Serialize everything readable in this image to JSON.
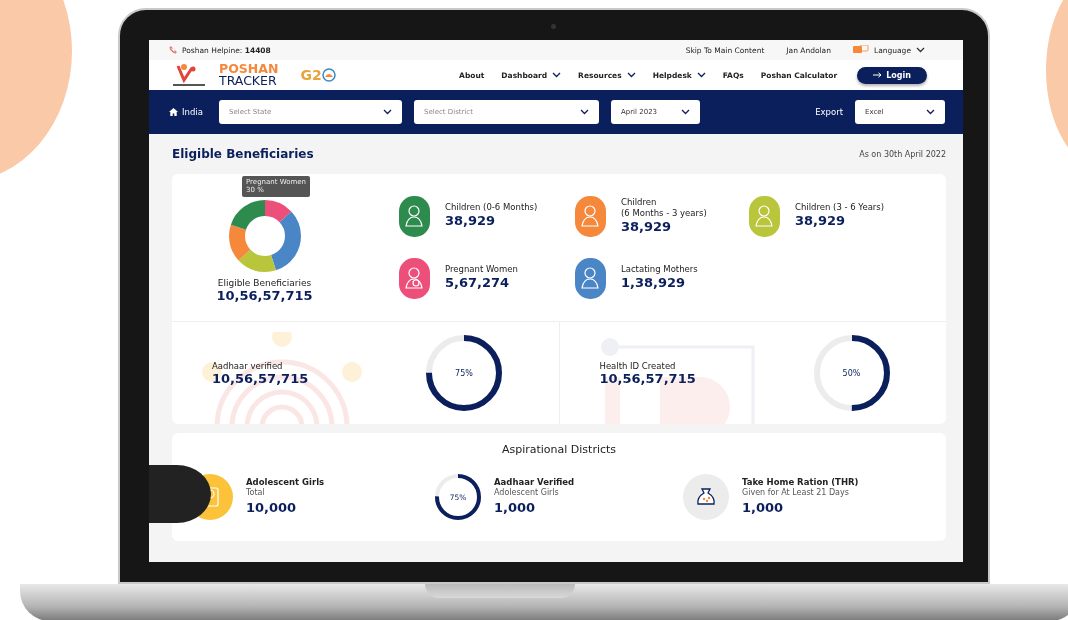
{
  "top_bar": {
    "helpline_label": "Poshan Helpine:",
    "helpline_number": "14408",
    "links": [
      "Skip To Main Content",
      "Jan Andolan"
    ],
    "language": "Language"
  },
  "header": {
    "brand_top": "POSHAN",
    "brand_bottom": "TRACKER",
    "g20": "G2",
    "nav": [
      {
        "label": "About",
        "dropdown": false
      },
      {
        "label": "Dashboard",
        "dropdown": true
      },
      {
        "label": "Resources",
        "dropdown": true
      },
      {
        "label": "Helpdesk",
        "dropdown": true
      },
      {
        "label": "FAQs",
        "dropdown": false
      },
      {
        "label": "Poshan Calculator",
        "dropdown": false
      }
    ],
    "login": "Login"
  },
  "filters": {
    "home": "India",
    "state": {
      "placeholder": "Select State"
    },
    "district": {
      "placeholder": "Select District"
    },
    "month": "April 2023",
    "export_label": "Export",
    "export_format": "Excel"
  },
  "eligible": {
    "title": "Eligible Beneficiaries",
    "as_on": "As on 30th April 2022",
    "donut": {
      "tooltip_title": "Pregnant Women",
      "tooltip_value": "30 %",
      "label": "Eligible Beneficiaries",
      "total": "10,56,57,715"
    },
    "groups": [
      {
        "label": "Children (0-6 Months)",
        "value": "38,929",
        "color": "#2e8b4e"
      },
      {
        "label": "Children",
        "sublabel": "(6 Months - 3 years)",
        "value": "38,929",
        "color": "#f5883a"
      },
      {
        "label": "Children (3 - 6 Years)",
        "value": "38,929",
        "color": "#b9c53a"
      },
      {
        "label": "Pregnant Women",
        "value": "5,67,274",
        "color": "#ec4f7a"
      },
      {
        "label": "Lactating Mothers",
        "value": "1,38,929",
        "color": "#4a86c5"
      }
    ]
  },
  "verification": [
    {
      "kind": "fingerprint",
      "label": "Aadhaar verified",
      "value": "10,56,57,715",
      "level": 0.75,
      "percent": "75%"
    },
    {
      "kind": "id",
      "label": "Health ID Created",
      "value": "10,56,57,715",
      "level": 0.5,
      "percent": "50%"
    }
  ],
  "aspirational": {
    "title": "Aspirational Districts",
    "items": [
      {
        "kind": "icon",
        "title": "Adolescent Girls",
        "subtitle": "Total",
        "value": "10,000",
        "color": "#fcc23a"
      },
      {
        "kind": "ring",
        "title": "Aadhaar Verified",
        "subtitle": "Adolescent Girls",
        "value": "1,000",
        "level": 0.75,
        "percent": "75%"
      },
      {
        "kind": "icon",
        "title": "Take Home Ration (THR)",
        "subtitle": "Given for At Least 21 Days",
        "value": "1,000",
        "color": "#ececec"
      }
    ]
  }
}
